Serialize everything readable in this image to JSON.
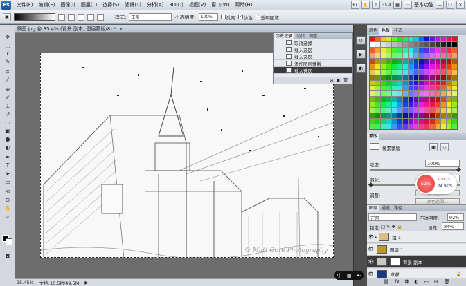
{
  "app": {
    "logo": "Ps"
  },
  "menu": [
    "文件(F)",
    "编辑(E)",
    "图像(I)",
    "图层(L)",
    "选择(S)",
    "滤镜(T)",
    "分析(A)",
    "3D(D)",
    "视图(V)",
    "窗口(W)",
    "帮助(H)"
  ],
  "topbar": {
    "zoom": "35.4",
    "workspace": "基本功能",
    "minimize": "—",
    "restore": "❐",
    "close": "✕"
  },
  "options": {
    "mode_label": "模式:",
    "mode_value": "正常",
    "opacity_label": "不透明度:",
    "opacity_value": "100%",
    "reverse": "反向",
    "dither": "仿色",
    "transparency": "透明区域"
  },
  "document": {
    "tab_title": "原图.jpg @ 35.4% (背景 副本, 图层蒙版/8) *",
    "close": "×",
    "watermark": "© Matt Gore Photography",
    "status_zoom": "35.45%",
    "status_doc": "文档:10.5M/49.5M"
  },
  "history": {
    "tabs": [
      "历史记录",
      "动作",
      "调整"
    ],
    "items": [
      "取消选择",
      "载入选区",
      "载入选区",
      "添加图层蒙版",
      "载入选区"
    ],
    "selected_index": 4
  },
  "swatches": {
    "tabs": [
      "颜色",
      "色板",
      "样式"
    ]
  },
  "masks": {
    "tab": "蒙版",
    "mask_type": "像素蒙版",
    "density_label": "浓度:",
    "density_value": "100%",
    "feather_label": "羽化:",
    "feather_value": "0 px",
    "refine_label": "调整:",
    "btn_mask_edge": "蒙版边缘...",
    "btn_color_range": "颜色范围...",
    "btn_invert": "反相"
  },
  "net": {
    "percent": "52%",
    "up": "1.6K/S",
    "down": "24.9K/S"
  },
  "layers": {
    "tabs": [
      "图层",
      "通道",
      "路径"
    ],
    "blend": "正常",
    "opacity_label": "不透明度:",
    "opacity_value": "92%",
    "lock_label": "锁定:",
    "fill_label": "填充:",
    "fill_value": "84%",
    "items": [
      {
        "name": "组 1",
        "thumb": "#d9c08a"
      },
      {
        "name": "图层 1",
        "thumb": "#b89a2e"
      },
      {
        "name": "背景 副本",
        "thumb": "#c7c7c7"
      },
      {
        "name": "背景",
        "thumb": "#1a3a7a"
      }
    ],
    "selected_index": 2
  },
  "ime": {
    "lang": "中"
  }
}
